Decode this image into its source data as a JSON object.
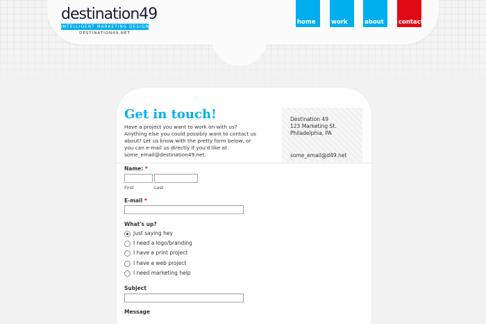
{
  "logo": {
    "wordmark": "destination49",
    "tagline": "INTELLIGENT MARKETING DESIGN",
    "url": "DESTINATION49.NET"
  },
  "nav": [
    {
      "label": "home",
      "color": "#00aef0"
    },
    {
      "label": "work",
      "color": "#00aef0"
    },
    {
      "label": "about",
      "color": "#00aef0"
    },
    {
      "label": "contact",
      "color": "#e20b13"
    }
  ],
  "page": {
    "title": "Get in touch!",
    "intro": "Have a project you want to work on with us? Anything else you could possibly want to contact us about? Let us know with the pretty form below, or you can e-mail us directly if you'd like at some_email@destination49.net."
  },
  "contact_card": {
    "name": "Destination 49",
    "street": "123 Marketing St.",
    "city": "Philadelphia, PA",
    "email": "some_email@d49.net"
  },
  "form": {
    "required_marker": "*",
    "name": {
      "label": "Name:",
      "first_sub": "First",
      "last_sub": "Last",
      "first_value": "",
      "last_value": ""
    },
    "email": {
      "label": "E-mail",
      "value": ""
    },
    "whats_up": {
      "label": "What's up?",
      "options": [
        {
          "label": "Just saying hey",
          "checked": true
        },
        {
          "label": "I need a logo/branding",
          "checked": false
        },
        {
          "label": "I have a print project",
          "checked": false
        },
        {
          "label": "I have a web project",
          "checked": false
        },
        {
          "label": "I need marketing help",
          "checked": false
        }
      ]
    },
    "subject": {
      "label": "Subject",
      "value": ""
    },
    "message": {
      "label": "Message"
    }
  },
  "colors": {
    "accent": "#00aef0",
    "contact_red": "#e20b13",
    "required": "#e20b13"
  }
}
